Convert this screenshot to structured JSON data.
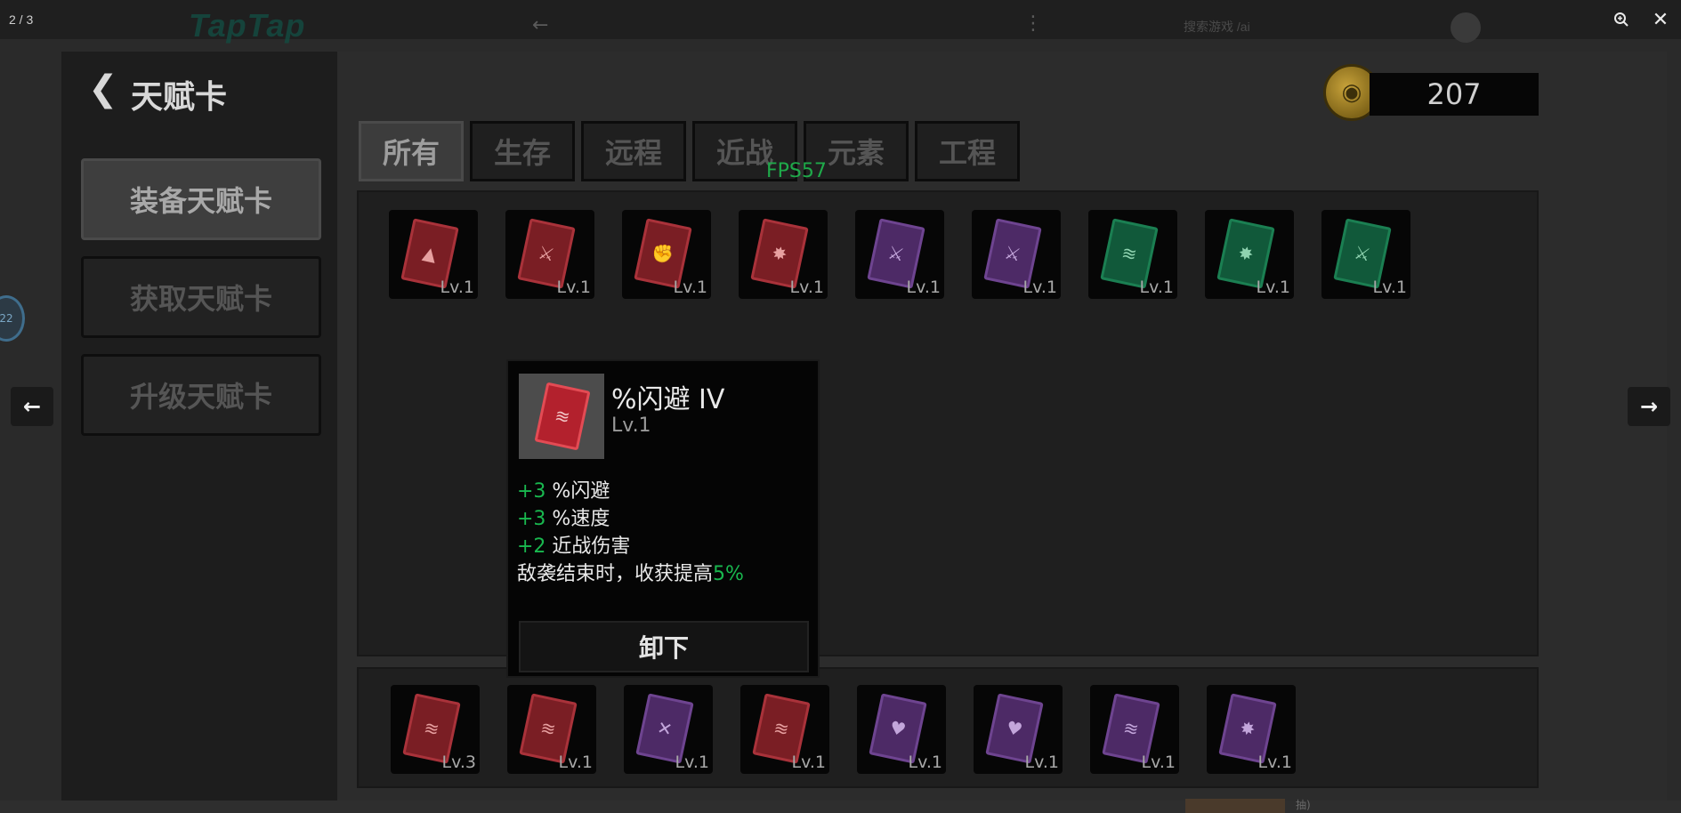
{
  "viewer": {
    "counter": "2 / 3",
    "bg_logo": "TapTap",
    "bg_search": "搜索游戏 /ai",
    "zoom_icon": "zoom-in-icon",
    "close_icon": "close-icon",
    "bottom_text": "抽)"
  },
  "side_badge": "22",
  "left_panel": {
    "title": "天赋卡",
    "menu": [
      {
        "label": "装备天赋卡",
        "active": true
      },
      {
        "label": "获取天赋卡",
        "active": false
      },
      {
        "label": "升级天赋卡",
        "active": false
      }
    ]
  },
  "currency": {
    "amount": "207",
    "icon": "coin-icon"
  },
  "tabs": [
    {
      "label": "所有",
      "active": true
    },
    {
      "label": "生存",
      "active": false
    },
    {
      "label": "远程",
      "active": false
    },
    {
      "label": "近战",
      "active": false
    },
    {
      "label": "元素",
      "active": false
    },
    {
      "label": "工程",
      "active": false
    }
  ],
  "fps": "FPS57",
  "inventory_cards": [
    {
      "color": "red",
      "symbol": "boot",
      "level": "Lv.1"
    },
    {
      "color": "red",
      "symbol": "sword",
      "level": "Lv.1"
    },
    {
      "color": "red",
      "symbol": "fist",
      "level": "Lv.1"
    },
    {
      "color": "red",
      "symbol": "star",
      "level": "Lv.1"
    },
    {
      "color": "purple",
      "symbol": "sword",
      "level": "Lv.1"
    },
    {
      "color": "purple",
      "symbol": "sword",
      "level": "Lv.1"
    },
    {
      "color": "green",
      "symbol": "wind",
      "level": "Lv.1"
    },
    {
      "color": "green",
      "symbol": "star",
      "level": "Lv.1"
    },
    {
      "color": "green",
      "symbol": "sword",
      "level": "Lv.1"
    }
  ],
  "equipped_cards": [
    {
      "color": "red",
      "symbol": "wind",
      "level": "Lv.3"
    },
    {
      "color": "red",
      "symbol": "wind",
      "level": "Lv.1"
    },
    {
      "color": "purple",
      "symbol": "cross",
      "level": "Lv.1"
    },
    {
      "color": "red",
      "symbol": "wind",
      "level": "Lv.1"
    },
    {
      "color": "purple",
      "symbol": "heart",
      "level": "Lv.1"
    },
    {
      "color": "purple",
      "symbol": "heart",
      "level": "Lv.1"
    },
    {
      "color": "purple",
      "symbol": "wind",
      "level": "Lv.1"
    },
    {
      "color": "purple",
      "symbol": "star",
      "level": "Lv.1"
    }
  ],
  "tooltip": {
    "name": "%闪避 IV",
    "level": "Lv.1",
    "stats": [
      {
        "num": "+3",
        "text": " %闪避"
      },
      {
        "num": "+3",
        "text": " %速度"
      },
      {
        "num": "+2",
        "text": " 近战伤害"
      }
    ],
    "effect_text": "敌袭结束时，收获提高",
    "effect_value": "5%",
    "button": "卸下"
  },
  "colors": {
    "highlight_green": "#19b84f",
    "red_card": "#a9323a",
    "purple_card": "#6e4490",
    "green_card": "#1b7f52"
  }
}
